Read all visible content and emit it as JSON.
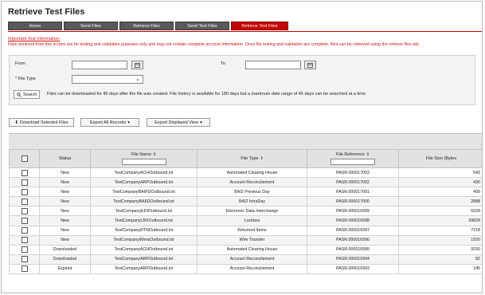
{
  "page": {
    "title": "Retrieve Test Files"
  },
  "tabs": [
    {
      "label": "Home",
      "active": false
    },
    {
      "label": "Send Files",
      "active": false
    },
    {
      "label": "Retrieve Files",
      "active": false
    },
    {
      "label": "Send Test Files",
      "active": false
    },
    {
      "label": "Retrieve Test Files",
      "active": true
    }
  ],
  "notice": {
    "title": "Important Test Information:",
    "text": "Files retrieved from this screen are for testing and validation purposes only and may not contain complete account information.  Once file testing and validation are complete, files can be retrieved using the retrieve files tab."
  },
  "filter": {
    "from_label": "From",
    "to_label": "To",
    "from_value": "",
    "to_value": "",
    "file_type_label": "* File Type",
    "file_type_value": "",
    "search_label": "Search",
    "help_text": "Files can be downloaded for 45 days after the file was created. File history is available for 180 days but a maximum date range of 45 days can be searched at a time."
  },
  "actions": {
    "download_selected": "Download Selected Files",
    "export_all": "Export All Records",
    "export_displayed": "Export Displayed View"
  },
  "table": {
    "columns": [
      "",
      "Status",
      "File Name",
      "File Type",
      "File Reference",
      "File Size (Bytes"
    ],
    "rows": [
      {
        "status": "New",
        "file_name": "TestCompanyACHOutbound.txt",
        "file_type": "Automated Clearing House",
        "file_reference": "PASR.000017003",
        "file_size": "543"
      },
      {
        "status": "New",
        "file_name": "TestCompanyARPOutbound.txt",
        "file_type": "Account Reconcilement",
        "file_reference": "PASR.000017002",
        "file_size": "430"
      },
      {
        "status": "New",
        "file_name": "TestCompanyBAIPDOutbound.txt",
        "file_type": "BAI2 Previous Day",
        "file_reference": "PASR.000017001",
        "file_size": "409"
      },
      {
        "status": "New",
        "file_name": "TestCompanyBAIIDOutbound.txt",
        "file_type": "BAI2 IntraDay",
        "file_reference": "PASR.000017000",
        "file_size": "2888"
      },
      {
        "status": "New",
        "file_name": "TestCompanyEDIOutbound.txt",
        "file_type": "Electronic Data Interchange",
        "file_reference": "PASR.000016999",
        "file_size": "5928"
      },
      {
        "status": "New",
        "file_name": "TestCompanyLBXOutbound.txt",
        "file_type": "Lockbox",
        "file_reference": "PASR.000016998",
        "file_size": "39828"
      },
      {
        "status": "New",
        "file_name": "TestCompanyRTNOutbound.txt",
        "file_type": "Returned Items",
        "file_reference": "PASR.000016997",
        "file_size": "7218"
      },
      {
        "status": "New",
        "file_name": "TestCompanyWiresOutbound.txt",
        "file_type": "Wire Transfer",
        "file_reference": "PASR.000016996",
        "file_size": "1920"
      },
      {
        "status": "Downloaded",
        "file_name": "TestCompanyACHOutbound.txt",
        "file_type": "Automated Clearing House",
        "file_reference": "PASR.000016995",
        "file_size": "9250"
      },
      {
        "status": "Downloaded",
        "file_name": "TestCompanyARPOutbound.txt",
        "file_type": "Account Reconcilement",
        "file_reference": "PASR.000016994",
        "file_size": "82"
      },
      {
        "status": "Expired",
        "file_name": "TestCompanyARPOutbound.txt",
        "file_type": "Account Reconcilement",
        "file_reference": "PASR.000016993",
        "file_size": "145"
      }
    ]
  }
}
